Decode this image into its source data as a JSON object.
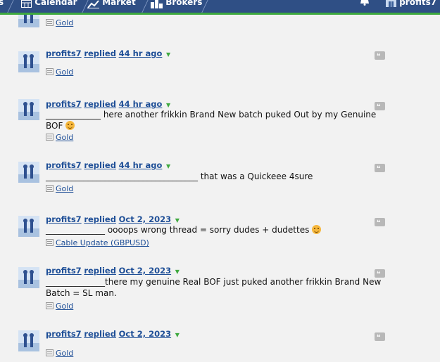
{
  "nav": {
    "tabs": [
      {
        "label": "s",
        "icon": ""
      },
      {
        "label": "Calendar",
        "icon": "calendar-icon"
      },
      {
        "label": "Market",
        "icon": "chart-icon"
      },
      {
        "label": "Brokers",
        "icon": "brokers-icon"
      }
    ],
    "bell_icon": "bell-icon",
    "user": "profits7"
  },
  "posts": [
    {
      "author": "",
      "action": "",
      "time": "",
      "message": "",
      "thread": "Gold"
    },
    {
      "author": "profits7",
      "action": "replied",
      "time": "44 hr ago",
      "message": "",
      "thread": "Gold"
    },
    {
      "author": "profits7",
      "action": "replied",
      "time": "44 hr ago",
      "message": "_____________ here another frikkin Brand New batch puked Out by my Genuine BOF",
      "thread": "Gold"
    },
    {
      "author": "profits7",
      "action": "replied",
      "time": "44 hr ago",
      "message": "____________________________________ that was a Quickeee 4sure",
      "thread": "Gold"
    },
    {
      "author": "profits7",
      "action": "replied",
      "time": "Oct 2, 2023",
      "message": "______________ oooops wrong thread = sorry dudes + dudettes",
      "thread": "Cable Update (GBPUSD)"
    },
    {
      "author": "profits7",
      "action": "replied",
      "time": "Oct 2, 2023",
      "message": "______________there my genuine Real BOF just puked another frikkin Brand New Batch = SL man.",
      "thread": "Gold"
    },
    {
      "author": "profits7",
      "action": "replied",
      "time": "Oct 2, 2023",
      "message": "",
      "thread": "Gold"
    }
  ]
}
